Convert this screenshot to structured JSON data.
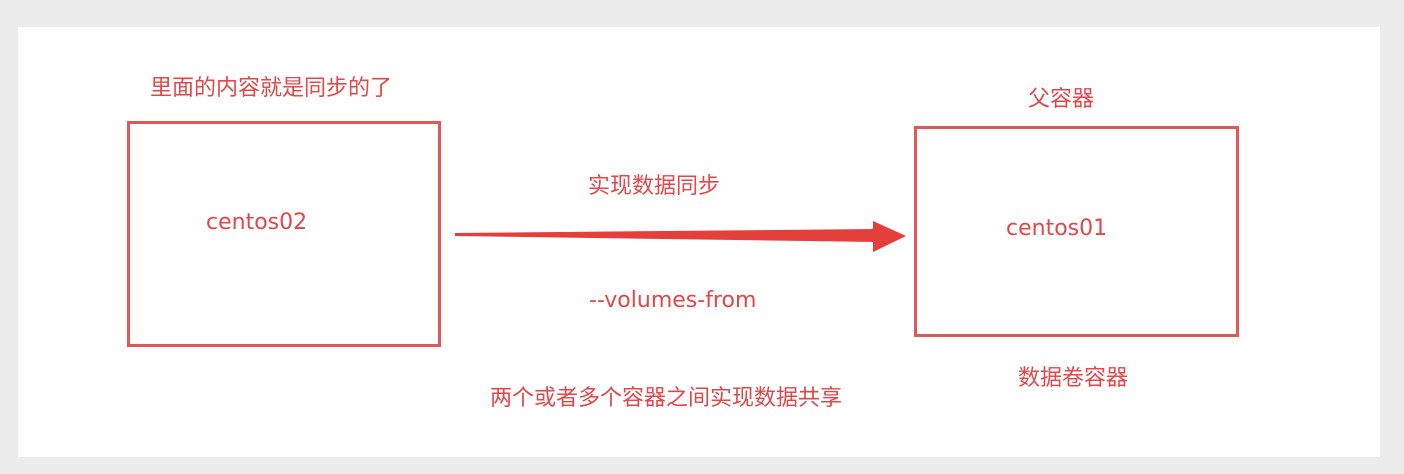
{
  "diagram": {
    "left_box": {
      "top_note": "里面的内容就是同步的了",
      "label": "centos02"
    },
    "right_box": {
      "top_note": "父容器",
      "label": "centos01",
      "bottom_note": "数据卷容器"
    },
    "arrow": {
      "top_label": "实现数据同步",
      "bottom_label": "--volumes-from"
    },
    "footer": "两个或者多个容器之间实现数据共享",
    "colors": {
      "accent": "#e2474a",
      "box_border": "#e0585a",
      "arrow": "#e53f3c"
    }
  }
}
